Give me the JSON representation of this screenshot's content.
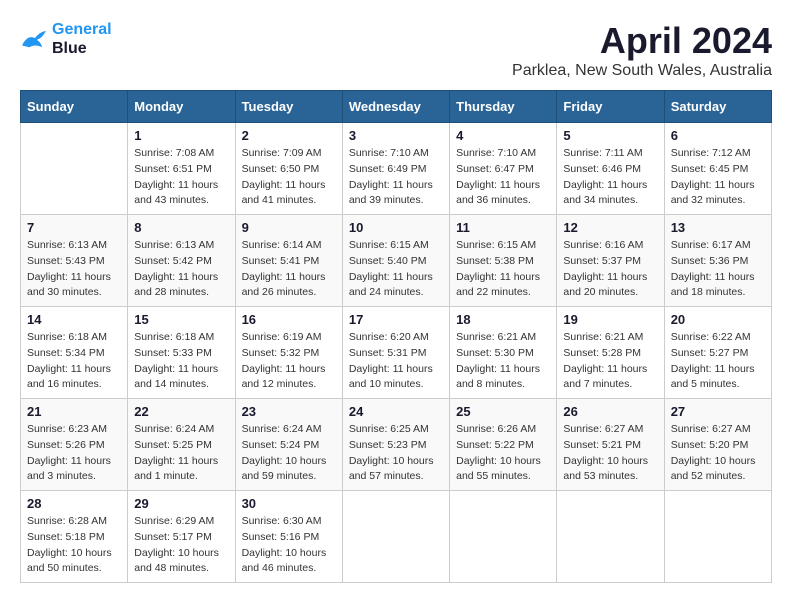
{
  "header": {
    "logo": {
      "line1": "General",
      "line2": "Blue"
    },
    "title": "April 2024",
    "subtitle": "Parklea, New South Wales, Australia"
  },
  "calendar": {
    "days_of_week": [
      "Sunday",
      "Monday",
      "Tuesday",
      "Wednesday",
      "Thursday",
      "Friday",
      "Saturday"
    ],
    "weeks": [
      [
        {
          "date": "",
          "info": ""
        },
        {
          "date": "1",
          "info": "Sunrise: 7:08 AM\nSunset: 6:51 PM\nDaylight: 11 hours\nand 43 minutes."
        },
        {
          "date": "2",
          "info": "Sunrise: 7:09 AM\nSunset: 6:50 PM\nDaylight: 11 hours\nand 41 minutes."
        },
        {
          "date": "3",
          "info": "Sunrise: 7:10 AM\nSunset: 6:49 PM\nDaylight: 11 hours\nand 39 minutes."
        },
        {
          "date": "4",
          "info": "Sunrise: 7:10 AM\nSunset: 6:47 PM\nDaylight: 11 hours\nand 36 minutes."
        },
        {
          "date": "5",
          "info": "Sunrise: 7:11 AM\nSunset: 6:46 PM\nDaylight: 11 hours\nand 34 minutes."
        },
        {
          "date": "6",
          "info": "Sunrise: 7:12 AM\nSunset: 6:45 PM\nDaylight: 11 hours\nand 32 minutes."
        }
      ],
      [
        {
          "date": "7",
          "info": "Sunrise: 6:13 AM\nSunset: 5:43 PM\nDaylight: 11 hours\nand 30 minutes."
        },
        {
          "date": "8",
          "info": "Sunrise: 6:13 AM\nSunset: 5:42 PM\nDaylight: 11 hours\nand 28 minutes."
        },
        {
          "date": "9",
          "info": "Sunrise: 6:14 AM\nSunset: 5:41 PM\nDaylight: 11 hours\nand 26 minutes."
        },
        {
          "date": "10",
          "info": "Sunrise: 6:15 AM\nSunset: 5:40 PM\nDaylight: 11 hours\nand 24 minutes."
        },
        {
          "date": "11",
          "info": "Sunrise: 6:15 AM\nSunset: 5:38 PM\nDaylight: 11 hours\nand 22 minutes."
        },
        {
          "date": "12",
          "info": "Sunrise: 6:16 AM\nSunset: 5:37 PM\nDaylight: 11 hours\nand 20 minutes."
        },
        {
          "date": "13",
          "info": "Sunrise: 6:17 AM\nSunset: 5:36 PM\nDaylight: 11 hours\nand 18 minutes."
        }
      ],
      [
        {
          "date": "14",
          "info": "Sunrise: 6:18 AM\nSunset: 5:34 PM\nDaylight: 11 hours\nand 16 minutes."
        },
        {
          "date": "15",
          "info": "Sunrise: 6:18 AM\nSunset: 5:33 PM\nDaylight: 11 hours\nand 14 minutes."
        },
        {
          "date": "16",
          "info": "Sunrise: 6:19 AM\nSunset: 5:32 PM\nDaylight: 11 hours\nand 12 minutes."
        },
        {
          "date": "17",
          "info": "Sunrise: 6:20 AM\nSunset: 5:31 PM\nDaylight: 11 hours\nand 10 minutes."
        },
        {
          "date": "18",
          "info": "Sunrise: 6:21 AM\nSunset: 5:30 PM\nDaylight: 11 hours\nand 8 minutes."
        },
        {
          "date": "19",
          "info": "Sunrise: 6:21 AM\nSunset: 5:28 PM\nDaylight: 11 hours\nand 7 minutes."
        },
        {
          "date": "20",
          "info": "Sunrise: 6:22 AM\nSunset: 5:27 PM\nDaylight: 11 hours\nand 5 minutes."
        }
      ],
      [
        {
          "date": "21",
          "info": "Sunrise: 6:23 AM\nSunset: 5:26 PM\nDaylight: 11 hours\nand 3 minutes."
        },
        {
          "date": "22",
          "info": "Sunrise: 6:24 AM\nSunset: 5:25 PM\nDaylight: 11 hours\nand 1 minute."
        },
        {
          "date": "23",
          "info": "Sunrise: 6:24 AM\nSunset: 5:24 PM\nDaylight: 10 hours\nand 59 minutes."
        },
        {
          "date": "24",
          "info": "Sunrise: 6:25 AM\nSunset: 5:23 PM\nDaylight: 10 hours\nand 57 minutes."
        },
        {
          "date": "25",
          "info": "Sunrise: 6:26 AM\nSunset: 5:22 PM\nDaylight: 10 hours\nand 55 minutes."
        },
        {
          "date": "26",
          "info": "Sunrise: 6:27 AM\nSunset: 5:21 PM\nDaylight: 10 hours\nand 53 minutes."
        },
        {
          "date": "27",
          "info": "Sunrise: 6:27 AM\nSunset: 5:20 PM\nDaylight: 10 hours\nand 52 minutes."
        }
      ],
      [
        {
          "date": "28",
          "info": "Sunrise: 6:28 AM\nSunset: 5:18 PM\nDaylight: 10 hours\nand 50 minutes."
        },
        {
          "date": "29",
          "info": "Sunrise: 6:29 AM\nSunset: 5:17 PM\nDaylight: 10 hours\nand 48 minutes."
        },
        {
          "date": "30",
          "info": "Sunrise: 6:30 AM\nSunset: 5:16 PM\nDaylight: 10 hours\nand 46 minutes."
        },
        {
          "date": "",
          "info": ""
        },
        {
          "date": "",
          "info": ""
        },
        {
          "date": "",
          "info": ""
        },
        {
          "date": "",
          "info": ""
        }
      ]
    ]
  }
}
